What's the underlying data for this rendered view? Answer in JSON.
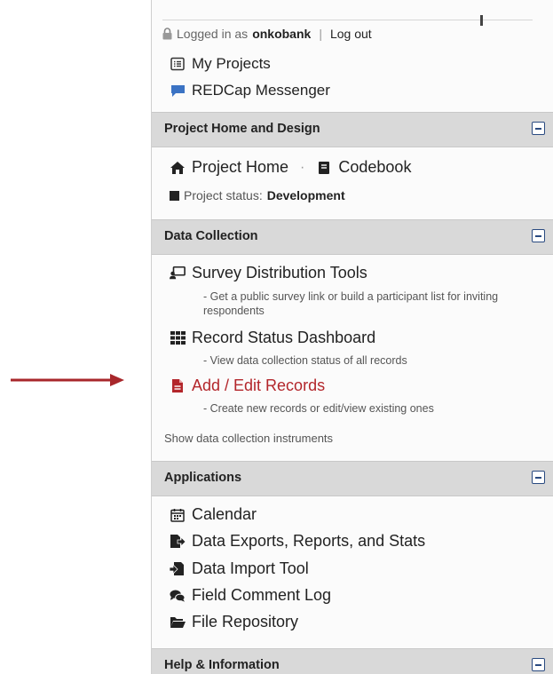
{
  "user_bar": {
    "prefix": "Logged in as",
    "username": "onkobank",
    "separator": "|",
    "logout": "Log out"
  },
  "top_links": [
    {
      "label": "My Projects",
      "icon": "list-icon"
    },
    {
      "label": "REDCap Messenger",
      "icon": "chat-bubble-icon"
    }
  ],
  "sections": {
    "project_home": {
      "title": "Project Home and Design",
      "home_label": "Project Home",
      "dot": "·",
      "codebook_label": "Codebook",
      "status_label": "Project status:",
      "status_value": "Development"
    },
    "data_collection": {
      "title": "Data Collection",
      "items": [
        {
          "label": "Survey Distribution Tools",
          "desc": "- Get a public survey link or build a participant list for inviting respondents"
        },
        {
          "label": "Record Status Dashboard",
          "desc": "- View data collection status of all records"
        },
        {
          "label": "Add / Edit Records",
          "desc": "- Create new records or edit/view existing ones"
        }
      ],
      "show_instruments": "Show data collection instruments"
    },
    "applications": {
      "title": "Applications",
      "items": [
        {
          "label": "Calendar",
          "icon": "calendar-icon"
        },
        {
          "label": "Data Exports, Reports, and Stats",
          "icon": "export-icon"
        },
        {
          "label": "Data Import Tool",
          "icon": "import-icon"
        },
        {
          "label": "Field Comment Log",
          "icon": "comments-icon"
        },
        {
          "label": "File Repository",
          "icon": "folder-icon"
        }
      ]
    },
    "help": {
      "title": "Help & Information"
    }
  },
  "colors": {
    "highlight_red": "#b3262b",
    "messenger_blue": "#3b73c4",
    "section_bg": "#d9d9d9"
  }
}
